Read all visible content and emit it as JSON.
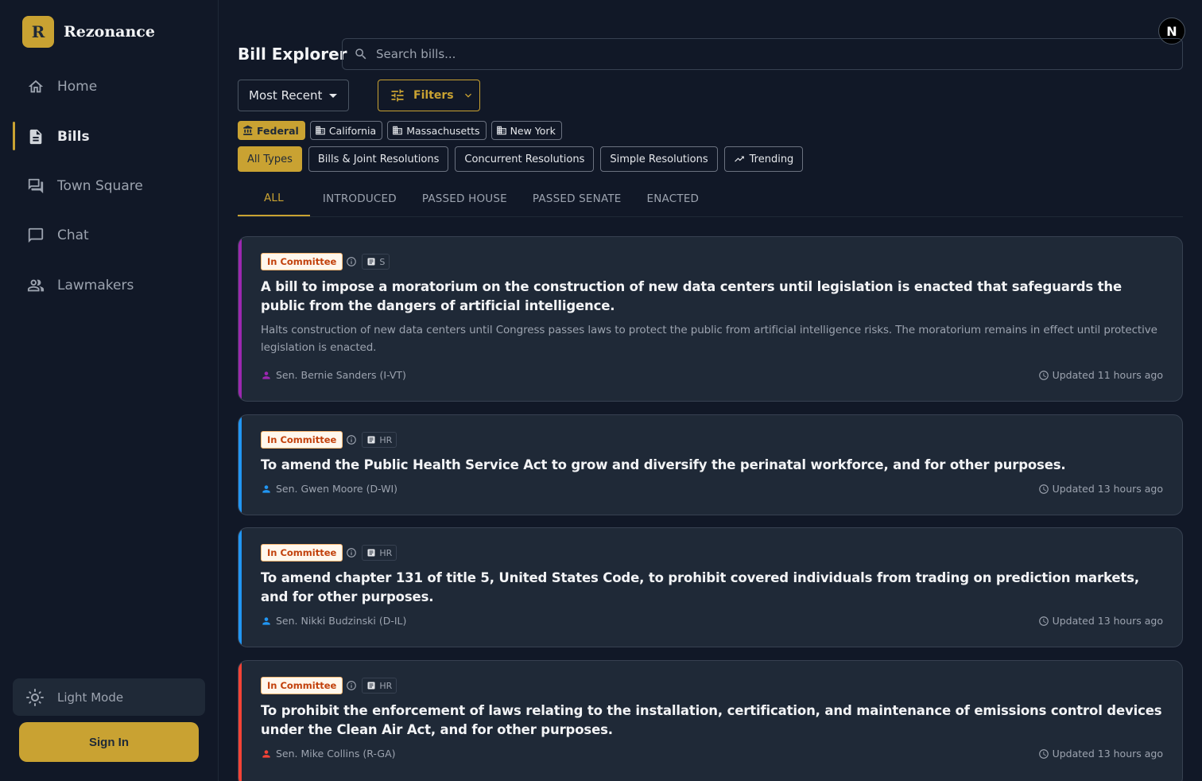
{
  "app": {
    "logo_letter": "R",
    "name": "Rezonance",
    "user_initial": "N"
  },
  "sidebar": {
    "items": [
      {
        "label": "Home",
        "icon": "home-icon"
      },
      {
        "label": "Bills",
        "icon": "document-icon"
      },
      {
        "label": "Town Square",
        "icon": "forum-icon"
      },
      {
        "label": "Chat",
        "icon": "chat-icon"
      },
      {
        "label": "Lawmakers",
        "icon": "people-icon"
      }
    ],
    "active_index": 1,
    "light_mode_label": "Light Mode",
    "sign_in_label": "Sign In"
  },
  "header": {
    "title": "Bill Explorer",
    "search_placeholder": "Search bills..."
  },
  "controls": {
    "sort_value": "Most Recent",
    "filters_label": "Filters",
    "jurisdictions": [
      "Federal",
      "California",
      "Massachusetts",
      "New York"
    ],
    "active_jurisdiction": "Federal",
    "types": [
      "All Types",
      "Bills & Joint Resolutions",
      "Concurrent Resolutions",
      "Simple Resolutions",
      "Trending"
    ],
    "active_type": "All Types"
  },
  "tabs": [
    "ALL",
    "INTRODUCED",
    "PASSED HOUSE",
    "PASSED SENATE",
    "ENACTED"
  ],
  "active_tab": "ALL",
  "colors": {
    "accent": "#c9a232",
    "independent": "#9c27b0",
    "democrat": "#2196f3",
    "republican": "#f44336"
  },
  "bills": [
    {
      "status": "In Committee",
      "chamber": "S",
      "title": "A bill to impose a moratorium on the construction of new data centers until legislation is enacted that safeguards the public from the dangers of artificial intelligence.",
      "summary": "Halts construction of new data centers until Congress passes laws to protect the public from artificial intelligence risks. The moratorium remains in effect until protective legislation is enacted.",
      "sponsor": "Sen. Bernie Sanders (I-VT)",
      "party_color": "#9c27b0",
      "updated": "Updated 11 hours ago"
    },
    {
      "status": "In Committee",
      "chamber": "HR",
      "title": "To amend the Public Health Service Act to grow and diversify the perinatal workforce, and for other purposes.",
      "summary": "",
      "sponsor": "Sen. Gwen Moore (D-WI)",
      "party_color": "#2196f3",
      "updated": "Updated 13 hours ago"
    },
    {
      "status": "In Committee",
      "chamber": "HR",
      "title": "To amend chapter 131 of title 5, United States Code, to prohibit covered individuals from trading on prediction markets, and for other purposes.",
      "summary": "",
      "sponsor": "Sen. Nikki Budzinski (D-IL)",
      "party_color": "#2196f3",
      "updated": "Updated 13 hours ago"
    },
    {
      "status": "In Committee",
      "chamber": "HR",
      "title": "To prohibit the enforcement of laws relating to the installation, certification, and maintenance of emissions control devices under the Clean Air Act, and for other purposes.",
      "summary": "",
      "sponsor": "Sen. Mike Collins (R-GA)",
      "party_color": "#f44336",
      "updated": "Updated 13 hours ago"
    }
  ]
}
